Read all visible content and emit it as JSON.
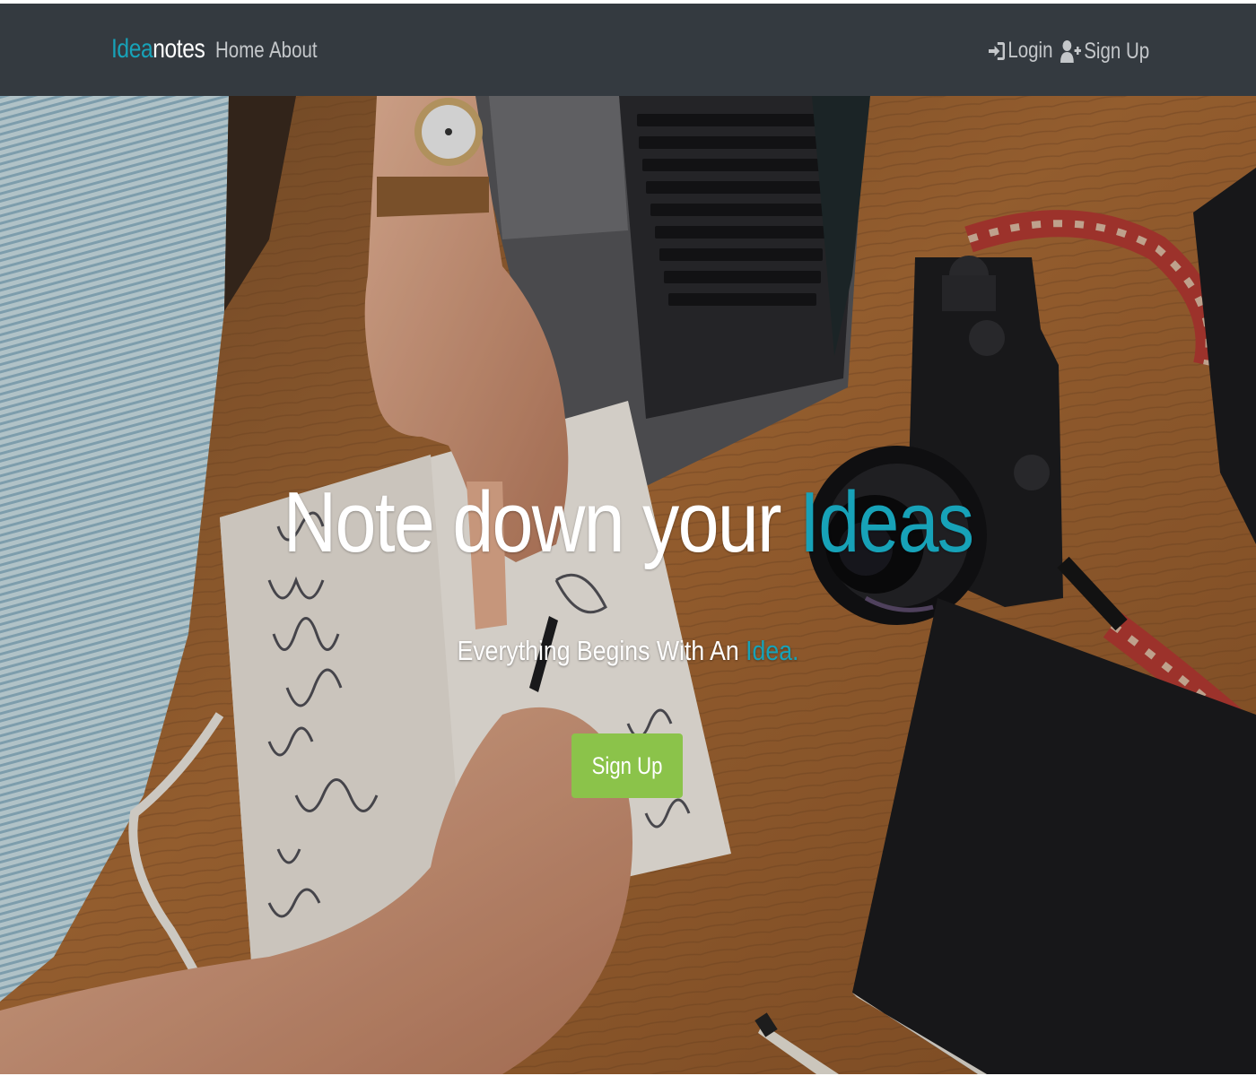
{
  "navbar": {
    "brand_part1": "Idea",
    "brand_part2": "notes",
    "links": [
      {
        "label": "Home"
      },
      {
        "label": "About"
      }
    ],
    "right_links": [
      {
        "label": "Login",
        "icon": "sign-in-icon"
      },
      {
        "label": "Sign Up",
        "icon": "user-plus-icon"
      }
    ],
    "colors": {
      "background": "#343a40",
      "brand_accent": "#17a2b8",
      "link": "#c4c7ca"
    }
  },
  "hero": {
    "title_main": "Note down your ",
    "title_accent": "Ideas",
    "subtitle_main": "Everything Begins With An ",
    "subtitle_accent": "Idea.",
    "cta_label": "Sign Up",
    "background_image": "desk-with-notebook-laptop-camera-photo",
    "colors": {
      "accent": "#17a2b8",
      "cta": "#8bc34a"
    }
  }
}
